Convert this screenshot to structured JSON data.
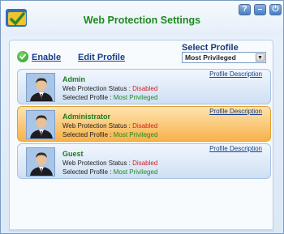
{
  "header": {
    "title": "Web Protection Settings",
    "buttons": [
      "?",
      "–",
      "⏻"
    ]
  },
  "toolbar": {
    "enable_label": "Enable",
    "edit_profile_label": "Edit Profile",
    "select_profile_label": "Select Profile",
    "select_profile_value": "Most Privileged"
  },
  "profiles": [
    {
      "name": "Admin",
      "status_label": "Web Protection Status :",
      "status_value": "Disabled",
      "profile_label": "Selected Profile :",
      "profile_value": "Most Privileged",
      "description_link": "Profile Description"
    },
    {
      "name": "Administrator",
      "status_label": "Web Protection Status :",
      "status_value": "Disabled",
      "profile_label": "Selected Profile :",
      "profile_value": "Most Privileged",
      "description_link": "Profile Description"
    },
    {
      "name": "Guest",
      "status_label": "Web Protection Status :",
      "status_value": "Disabled",
      "profile_label": "Selected Profile :",
      "profile_value": "Most Privileged",
      "description_link": "Profile Description"
    }
  ],
  "colors": {
    "title_green": "#1e8a1e",
    "disabled_red": "#d02020",
    "link_blue": "#163f8a",
    "selected_orange": "#f8b24a"
  }
}
